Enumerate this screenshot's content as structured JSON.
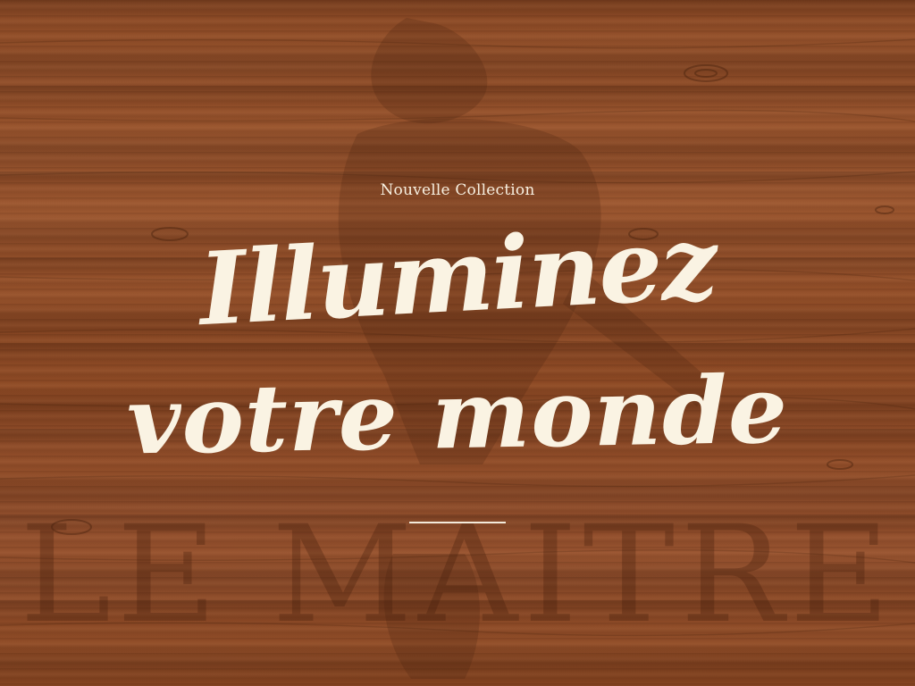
{
  "hero": {
    "eyebrow": "Nouvelle Collection",
    "headline_line1": "Illuminez",
    "headline_line2": "votre monde"
  },
  "watermark": {
    "text": "LE MAITRE"
  },
  "colors": {
    "wood_base": "#8a4a26",
    "text_cream": "#faf3e3",
    "watermark_tint": "#461e0c"
  }
}
